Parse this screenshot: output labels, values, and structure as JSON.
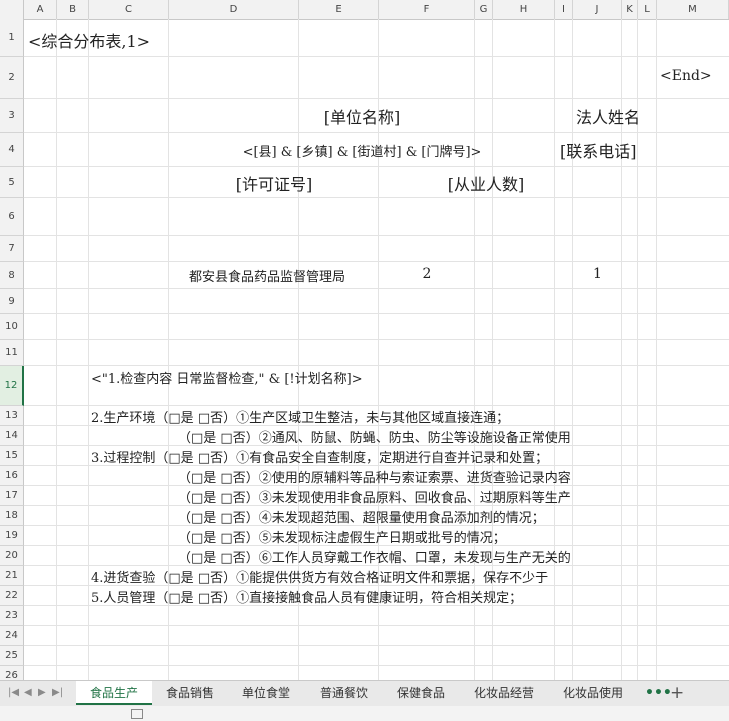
{
  "columns": [
    "A",
    "B",
    "C",
    "D",
    "E",
    "F",
    "G",
    "H",
    "I",
    "J",
    "K",
    "L",
    "M"
  ],
  "rows": [
    "1",
    "2",
    "3",
    "4",
    "5",
    "6",
    "7",
    "8",
    "9",
    "10",
    "11",
    "12",
    "13",
    "14",
    "15",
    "16",
    "17",
    "18",
    "19",
    "20",
    "21",
    "22",
    "23",
    "24",
    "25",
    "26"
  ],
  "active_row": "12",
  "cells": {
    "r1": "<综合分布表,1>",
    "end": "<End>",
    "unit_name": "[单位名称]",
    "legal_name": "法人姓名",
    "address": "<[县] & [乡镇] & [街道村] & [门牌号]>",
    "contact": "[联系电话]",
    "license": "[许可证号]",
    "staff": "[从业人数]",
    "r8_org": "都安县食品药品监督管理局",
    "r8_v1": "2",
    "r8_v2": "1",
    "r12": "<\"1.检查内容 日常监督检查,\" & [!计划名称]>",
    "r13": "2.生产环境（□是 □否）①生产区域卫生整洁，未与其他区域直接连通；",
    "r14": "（□是 □否）②通风、防鼠、防蝇、防虫、防尘等设施设备正常使用",
    "r15": "3.过程控制（□是 □否）①有食品安全自查制度，定期进行自查并记录和处置；",
    "r16": "（□是 □否）②使用的原辅料等品种与索证索票、进货查验记录内容",
    "r17": "（□是 □否）③未发现使用非食品原料、回收食品、过期原料等生产",
    "r18": "（□是 □否）④未发现超范围、超限量使用食品添加剂的情况；",
    "r19": "（□是 □否）⑤未发现标注虚假生产日期或批号的情况；",
    "r20": "（□是 □否）⑥工作人员穿戴工作衣帽、口罩，未发现与生产无关的",
    "r21": "4.进货查验（□是 □否）①能提供供货方有效合格证明文件和票据，保存不少于",
    "r22": "5.人员管理（□是 □否）①直接接触食品人员有健康证明，符合相关规定；"
  },
  "tabs": [
    "食品生产",
    "食品销售",
    "单位食堂",
    "普通餐饮",
    "保健食品",
    "化妆品经营",
    "化妆品使用"
  ],
  "active_tab": "食品生产",
  "tab_more": "•••",
  "tab_add": "+",
  "colors": {
    "accent": "#217346",
    "grid": "#e3e3e3",
    "header_bg": "#f2f2f2"
  }
}
